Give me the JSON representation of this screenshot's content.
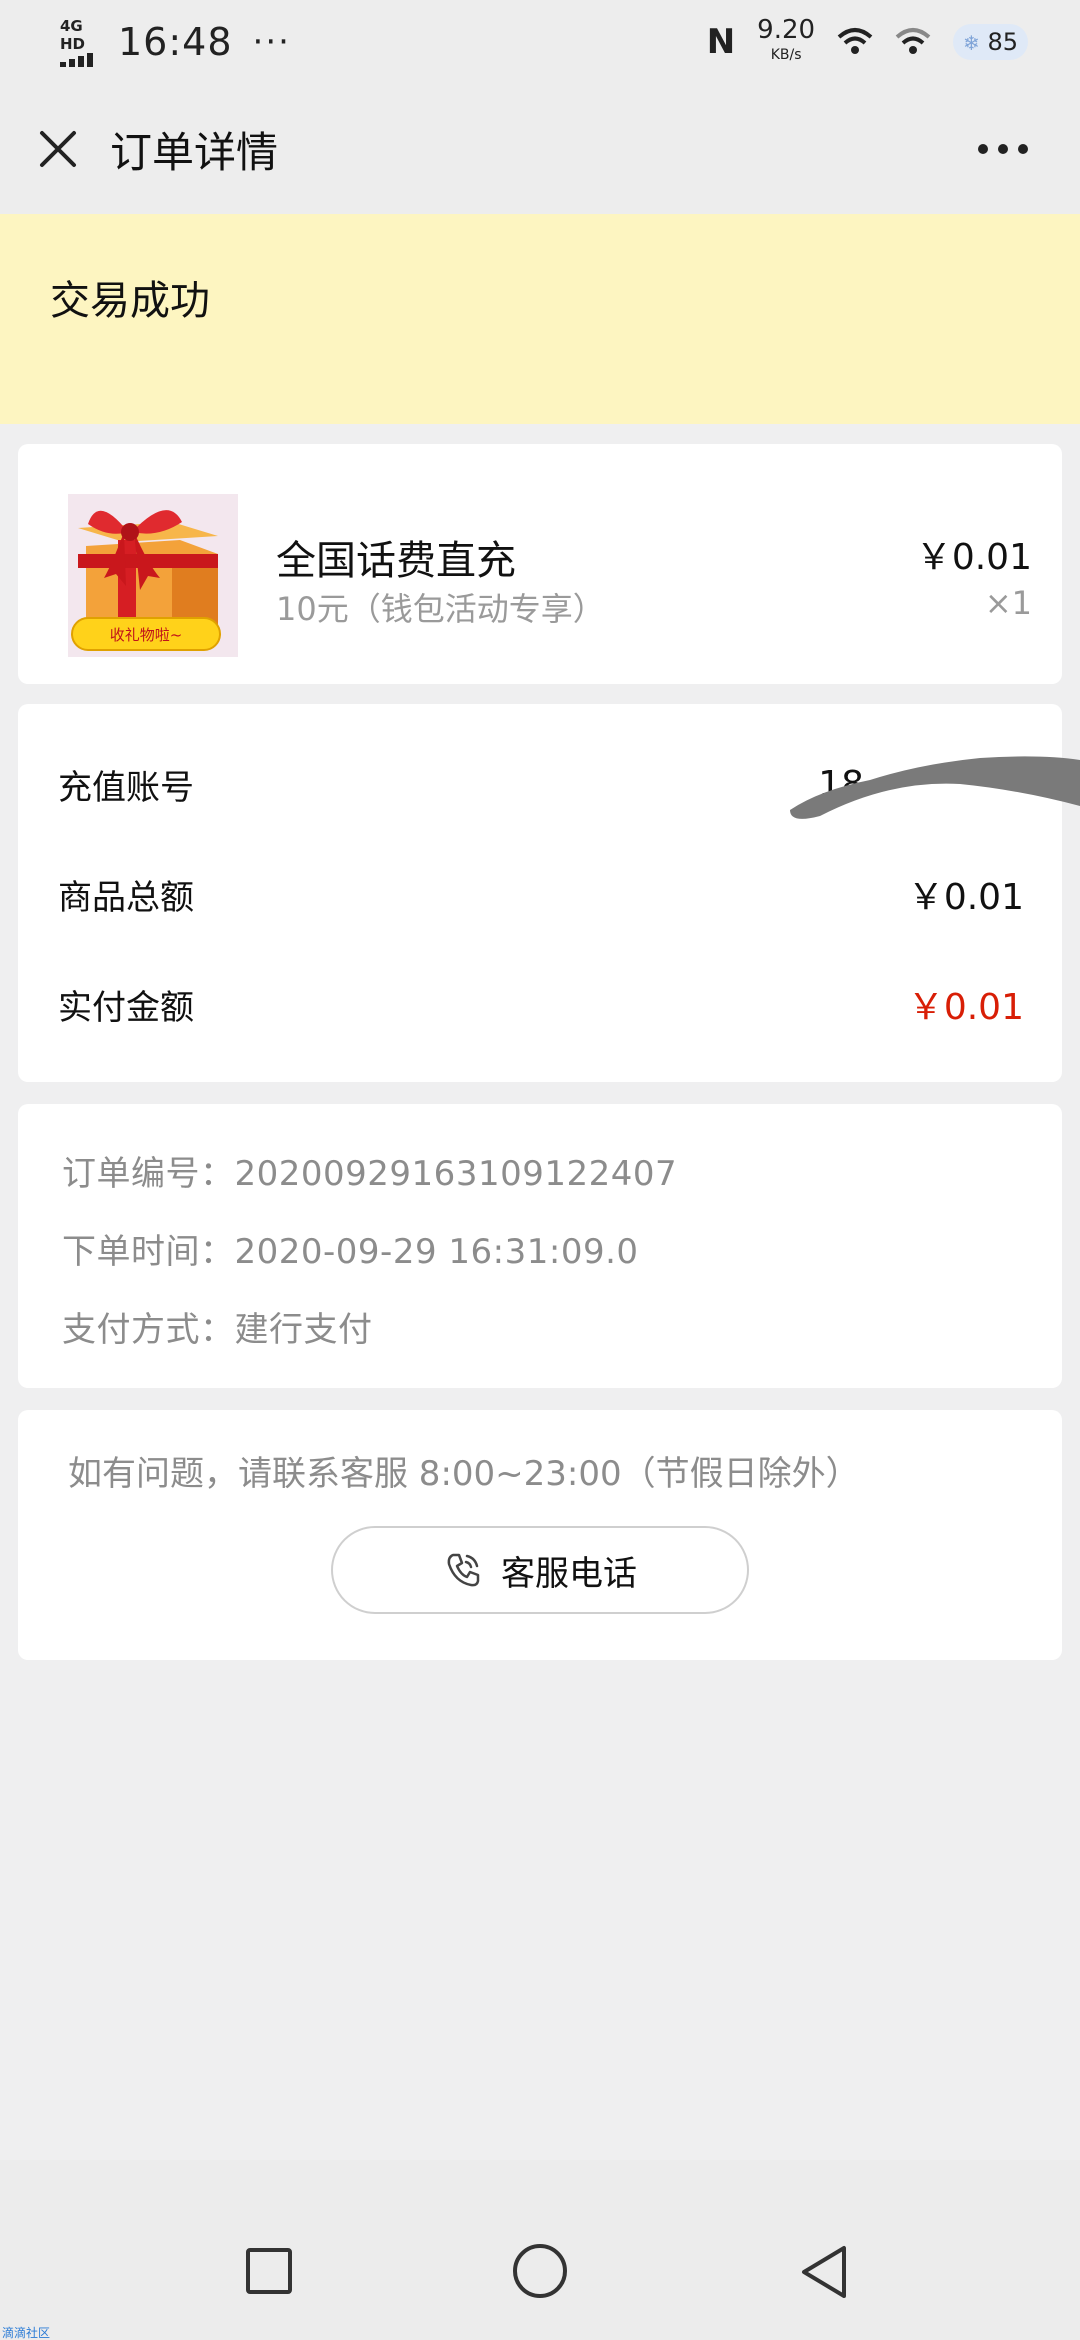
{
  "status_bar": {
    "network": "4G HD",
    "time": "16:48",
    "dots": "···",
    "nfc": "N",
    "speed_value": "9.20",
    "speed_unit": "KB/s",
    "battery": "85"
  },
  "header": {
    "title": "订单详情",
    "close_icon": "close-icon",
    "more_icon": "more-icon"
  },
  "banner": {
    "status": "交易成功"
  },
  "product": {
    "image_label": "收礼物啦~",
    "name": "全国话费直充",
    "desc": "10元（钱包活动专享）",
    "price": "￥0.01",
    "qty": "×1"
  },
  "amounts": {
    "account_label": "充值账号",
    "account_value": "18",
    "goods_total_label": "商品总额",
    "goods_total_value": "￥0.01",
    "paid_label": "实付金额",
    "paid_value": "￥0.01"
  },
  "order_info": [
    "订单编号：20200929163109122407",
    "下单时间：2020-09-29 16:31:09.0",
    "支付方式：建行支付"
  ],
  "help": {
    "text": "如有问题，请联系客服 8:00~23:00（节假日除外）",
    "phone_button": "客服电话",
    "phone_icon": "phone-icon"
  },
  "nav": {
    "recent_icon": "square-icon",
    "home_icon": "circle-icon",
    "back_icon": "triangle-back-icon"
  },
  "watermark": "滴滴社区",
  "colors": {
    "background": "#efeff0",
    "banner": "#fdf5c1",
    "price_red": "#d81e06"
  }
}
